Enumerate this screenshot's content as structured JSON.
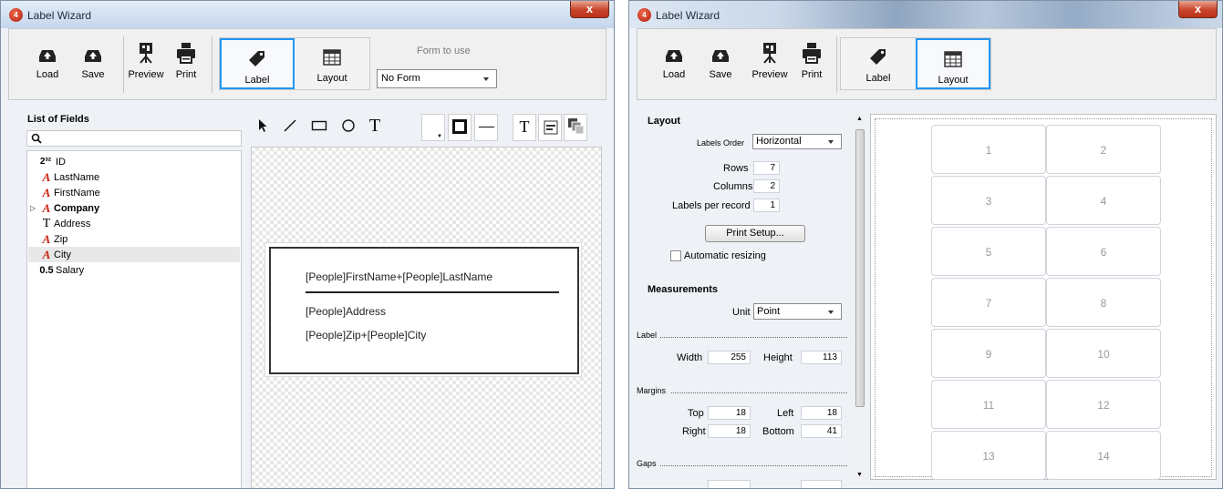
{
  "windows": [
    {
      "title": "Label Wizard",
      "close_label": "x",
      "toolbar": {
        "load": "Load",
        "save": "Save",
        "preview": "Preview",
        "print": "Print",
        "label_tab": "Label",
        "layout_tab": "Layout",
        "form_to_use": "Form to use",
        "form_value": "No Form"
      },
      "fields_panel": {
        "title": "List of Fields",
        "items": [
          {
            "type_icon": "2³²",
            "name": "ID"
          },
          {
            "type_icon": "A",
            "name": "LastName"
          },
          {
            "type_icon": "A",
            "name": "FirstName"
          },
          {
            "type_icon": "A",
            "name": "Company"
          },
          {
            "type_icon": "T",
            "name": "Address"
          },
          {
            "type_icon": "A",
            "name": "Zip"
          },
          {
            "type_icon": "A",
            "name": "City"
          },
          {
            "type_icon": "0.5",
            "name": "Salary"
          }
        ]
      },
      "tools": {
        "text_tool": "T",
        "font_tool": "T"
      },
      "label": {
        "line1": "[People]FirstName+[People]LastName",
        "line2": "[People]Address",
        "line3": "[People]Zip+[People]City"
      }
    },
    {
      "title": "Label Wizard",
      "close_label": "x",
      "toolbar": {
        "load": "Load",
        "save": "Save",
        "preview": "Preview",
        "print": "Print",
        "label_tab": "Label",
        "layout_tab": "Layout"
      },
      "layout": {
        "title": "Layout",
        "labels_order_label": "Labels Order",
        "labels_order_value": "Horizontal",
        "rows_label": "Rows",
        "rows": "7",
        "columns_label": "Columns",
        "columns": "2",
        "labels_per_record_label": "Labels per record",
        "labels_per_record": "1",
        "print_setup": "Print Setup...",
        "automatic_resizing": "Automatic resizing"
      },
      "measurements": {
        "title": "Measurements",
        "unit_label": "Unit",
        "unit_value": "Point",
        "label_section": "Label",
        "width_label": "Width",
        "width": "255",
        "height_label": "Height",
        "height": "113",
        "margins_section": "Margins",
        "top_label": "Top",
        "top": "18",
        "left_label": "Left",
        "left": "18",
        "right_label": "Right",
        "right": "18",
        "bottom_label": "Bottom",
        "bottom": "41",
        "gaps_section": "Gaps"
      },
      "preview_cells": [
        "1",
        "2",
        "3",
        "4",
        "5",
        "6",
        "7",
        "8",
        "9",
        "10",
        "11",
        "12",
        "13",
        "14"
      ]
    }
  ]
}
